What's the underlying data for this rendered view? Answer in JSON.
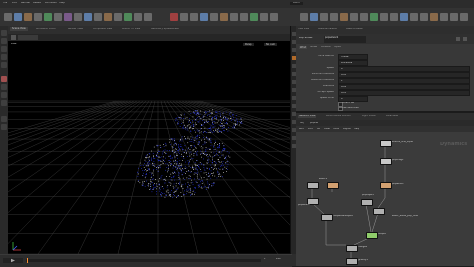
{
  "menubar": {
    "items": [
      "File",
      "Edit",
      "Render",
      "Assets",
      "Windows",
      "Help"
    ],
    "desktop": "Build"
  },
  "viewport": {
    "tabs": [
      "Scene View",
      "Animation Editor",
      "Render View",
      "Composite View",
      "Motion FX View",
      "Geometry Spreadsheet"
    ],
    "active_tab": "Scene View",
    "camera_menu": "Persp",
    "display_menu": "No cam"
  },
  "params": {
    "tabs": [
      "Tree View",
      "Material Palette",
      "Asset Browser"
    ],
    "node_type": "Pop Solver",
    "node_name": "popsolver1",
    "subtabs": [
      "Wind",
      "Solver",
      "Collision",
      "Inputs"
    ],
    "rows": [
      {
        "label": "Force Method",
        "value": "Follow"
      },
      {
        "label": "",
        "value": "Pre-Solve"
      },
      {
        "label": "Speed",
        "value": "0"
      },
      {
        "label": "Minimum Distance",
        "value": "0.05"
      },
      {
        "label": "Maximum Distance",
        "value": "1"
      },
      {
        "label": "Tolerance",
        "value": "0.01"
      },
      {
        "label": "Accept Speed",
        "value": "0.25"
      },
      {
        "label": "Speed Limit",
        "value": "0"
      }
    ],
    "toggles": [
      {
        "label": "Inherit Vel",
        "checked": true
      },
      {
        "label": "Use Velocities",
        "checked": true
      }
    ]
  },
  "network": {
    "tabs": [
      "Network View",
      "Performance Monitor",
      "Light Linker",
      "Parameter"
    ],
    "path": [
      "obj",
      "popnet"
    ],
    "menu": [
      "Add",
      "Edit",
      "Go",
      "View",
      "Tools",
      "Layout",
      "Help"
    ],
    "context_label": "Dynamics",
    "nodes": [
      {
        "name": "source_first_input",
        "color": "#c8c8c8"
      },
      {
        "name": "popdrag1",
        "color": "#c8c8c8"
      },
      {
        "name": "popwind1",
        "color": "#d2a070"
      },
      {
        "name": "static1",
        "color": "#b0b0b0"
      },
      {
        "name": "rbdpackedobject",
        "color": "#b0b0b0"
      },
      {
        "name": "popsolver",
        "color": "#b0b0b0"
      },
      {
        "name": "popobject",
        "color": "#b0b0b0"
      },
      {
        "name": "gravity1",
        "color": "#b0b0b0"
      },
      {
        "name": "merge1",
        "color": "#b0b0b0"
      },
      {
        "name": "output",
        "color": "#8fcc6a"
      },
      {
        "name": "static_solve_pop_flow",
        "color": "#b0b0b0"
      }
    ]
  },
  "timeline": {
    "start": "1",
    "end": "240",
    "current": "1"
  },
  "colors": {
    "particles": "#2b3bff",
    "particle_highlight": "#ffffff",
    "viewport_bg": "#000000",
    "grid": "#4a4a4a"
  },
  "icons": [
    "menu-icon",
    "gear-icon",
    "play-icon",
    "pin-icon",
    "home-icon"
  ]
}
